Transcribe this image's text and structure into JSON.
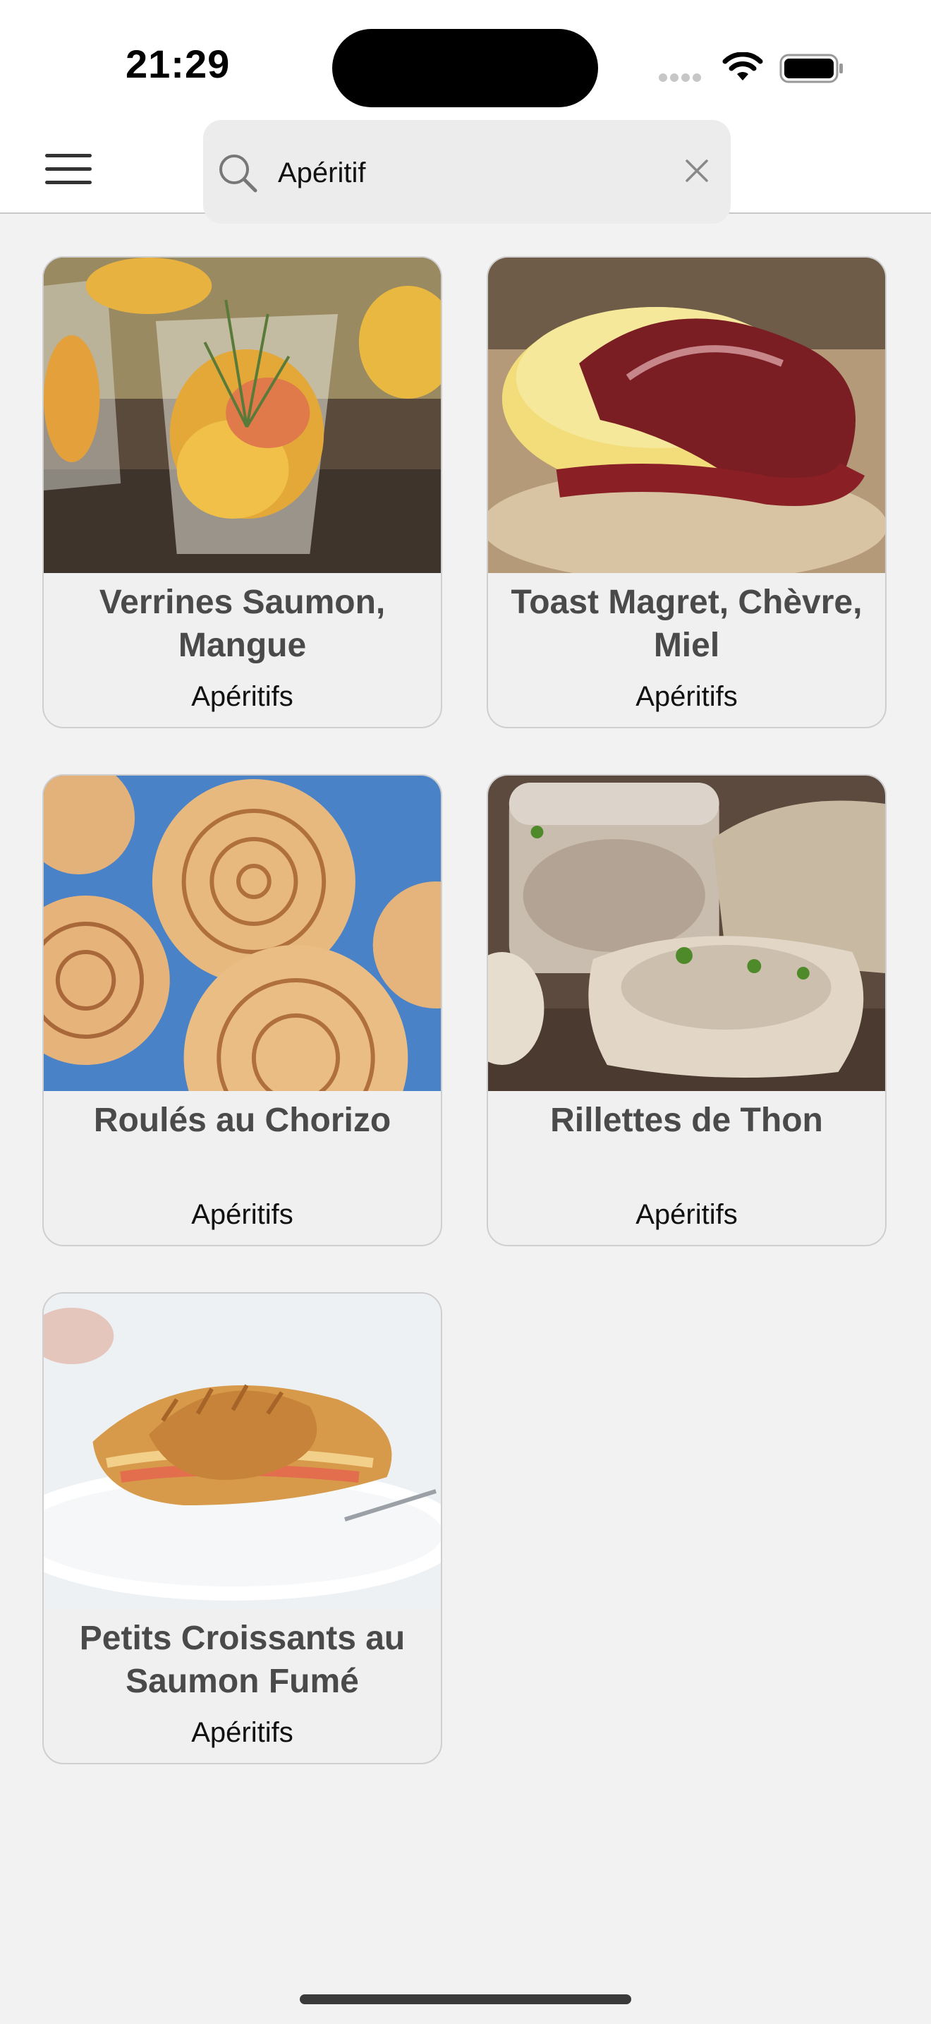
{
  "status_bar": {
    "time": "21:29"
  },
  "search": {
    "value": "Apéritif",
    "placeholder": ""
  },
  "recipes": [
    {
      "title": "Verrines Saumon, Mangue",
      "category": "Apéritifs"
    },
    {
      "title": "Toast Magret, Chèvre, Miel",
      "category": "Apéritifs"
    },
    {
      "title": "Roulés au Chorizo",
      "category": "Apéritifs"
    },
    {
      "title": "Rillettes de Thon",
      "category": "Apéritifs"
    },
    {
      "title": "Petits Croissants au Saumon Fumé",
      "category": "Apéritifs"
    }
  ],
  "icons": {
    "menu": "hamburger-icon",
    "search": "search-icon",
    "clear": "close-icon"
  }
}
